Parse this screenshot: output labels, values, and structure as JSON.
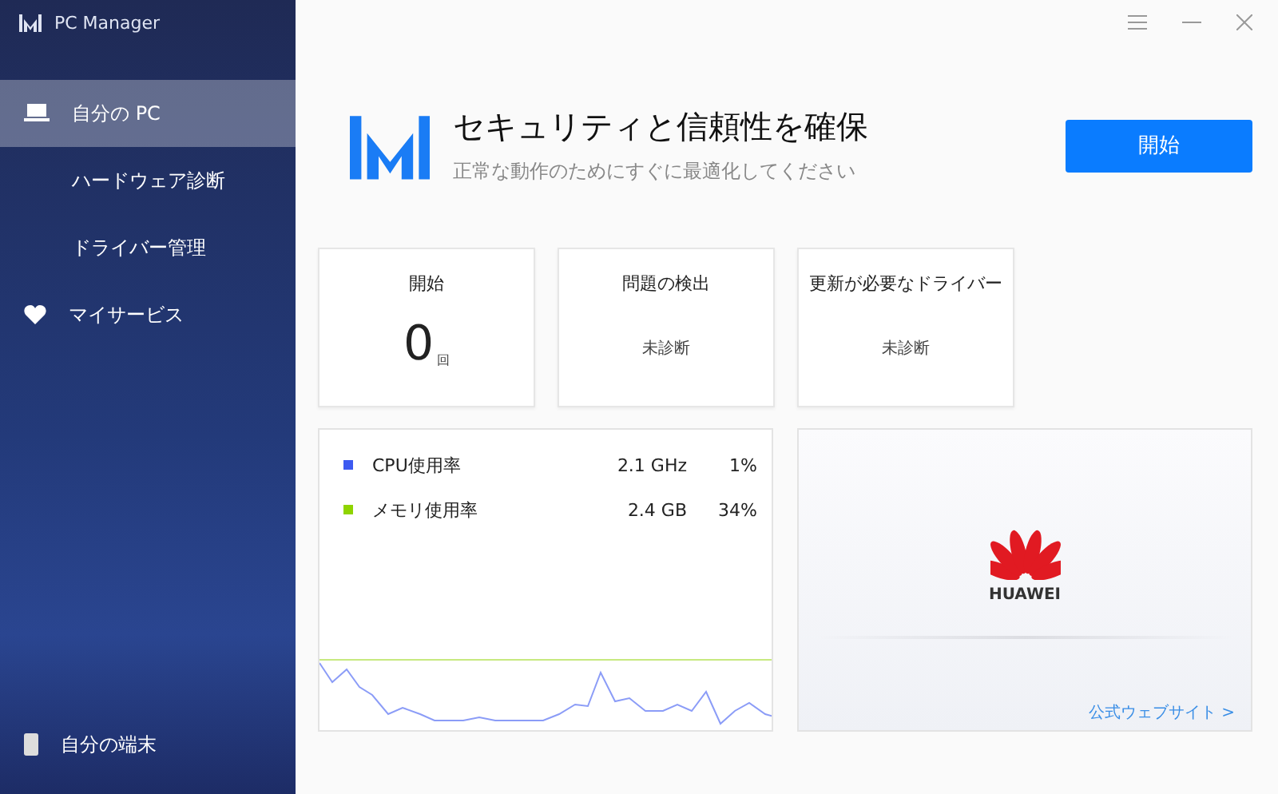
{
  "app": {
    "title": "PC Manager"
  },
  "nav": [
    {
      "label": "自分の PC",
      "kind": "device",
      "selected": true,
      "children": [
        {
          "label": "ハードウェア診断",
          "selected": false
        },
        {
          "label": "ドライバー管理",
          "selected": false
        }
      ]
    },
    {
      "label": "マイサービス",
      "kind": "service",
      "selected": false
    }
  ],
  "device": {
    "label": "自分の端末"
  },
  "hero": {
    "title": "セキュリティと信頼性を確保",
    "subtitle": "正常な動作のためにすぐに最適化してください",
    "button": "開始"
  },
  "stats": [
    {
      "title": "開始",
      "value": "0",
      "unit": "回",
      "kind": "count"
    },
    {
      "title": "問題の検出",
      "value": "未診断",
      "kind": "status"
    },
    {
      "title": "更新が必要なドライバー",
      "value": "未診断",
      "kind": "status"
    }
  ],
  "monitor": [
    {
      "label": "CPU使用率",
      "color": "#3d5af1",
      "detail": "2.1 GHz",
      "percent": "1%"
    },
    {
      "label": "メモリ使用率",
      "color": "#8fd400",
      "detail": "2.4 GB",
      "percent": "34%"
    }
  ],
  "brand": {
    "name": "HUAWEI",
    "link": "公式ウェブサイト >"
  }
}
